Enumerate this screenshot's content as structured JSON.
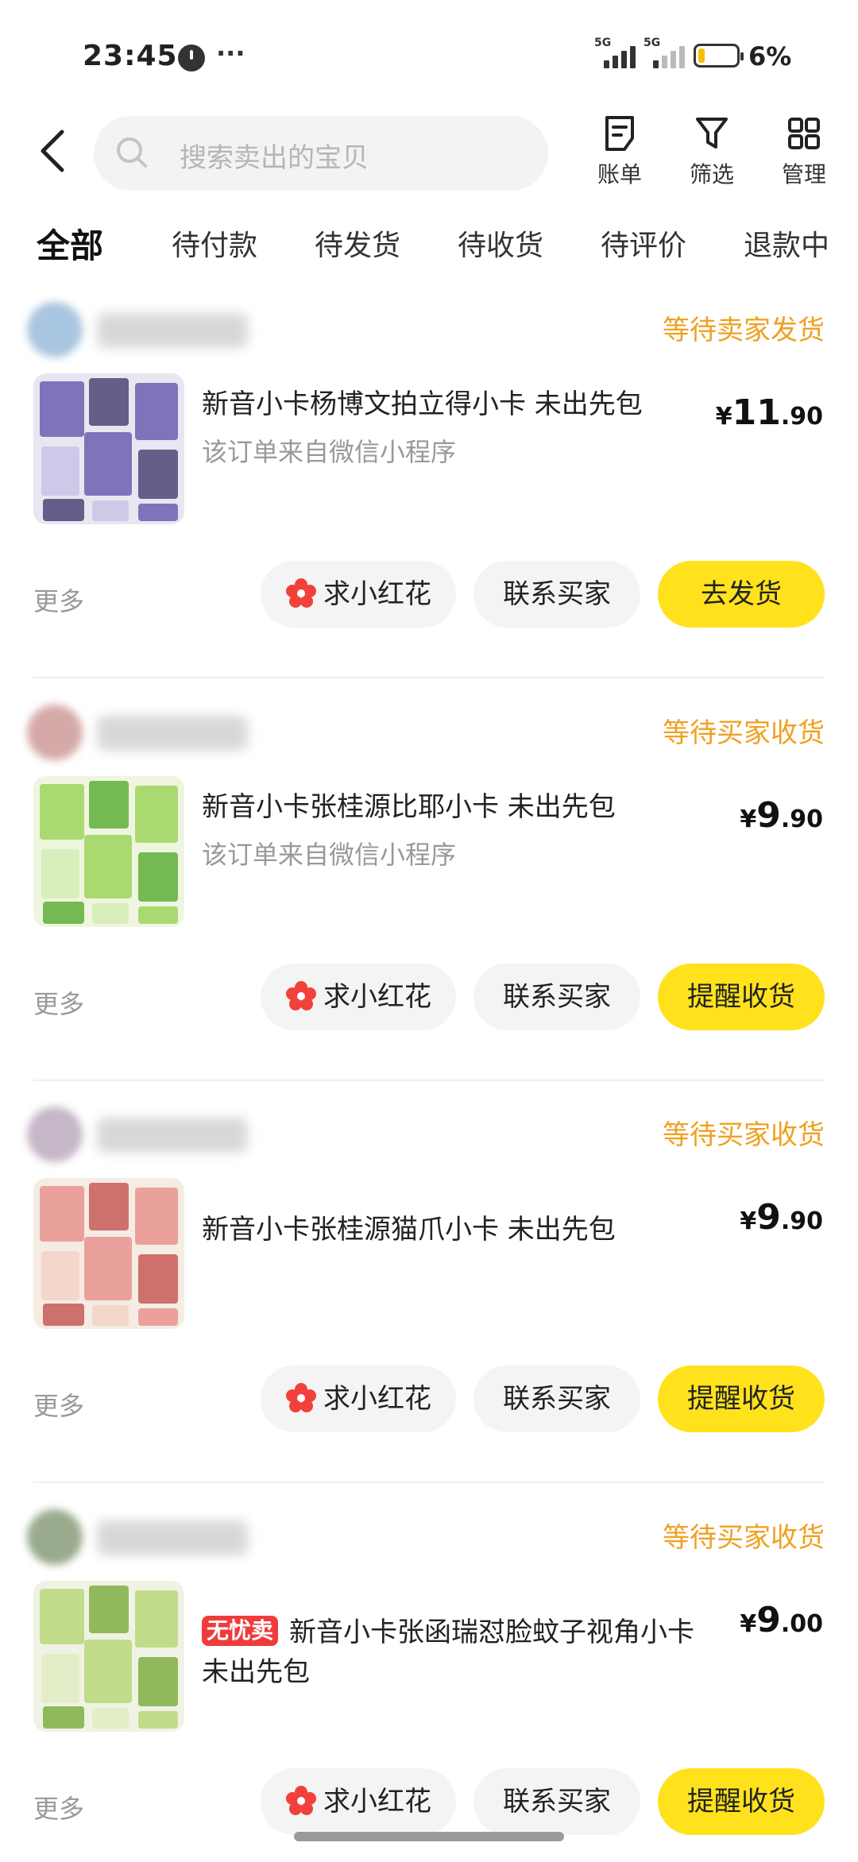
{
  "status_bar": {
    "time": "23:45",
    "overflow": "···",
    "net1": "5G",
    "net2": "5G",
    "battery_pct": "6%"
  },
  "header": {
    "search_placeholder": "搜索卖出的宝贝",
    "buttons": [
      {
        "label": "账单",
        "icon": "bill-icon"
      },
      {
        "label": "筛选",
        "icon": "filter-icon"
      },
      {
        "label": "管理",
        "icon": "grid-icon"
      }
    ]
  },
  "tabs": [
    "全部",
    "待付款",
    "待发货",
    "待收货",
    "待评价",
    "退款中"
  ],
  "orders": [
    {
      "status": "等待卖家发货",
      "badge": "",
      "title": "新音小卡杨博文拍立得小卡 未出先包",
      "source": "该订单来自微信小程序",
      "price_int": "11",
      "price_dec": ".90",
      "more": "更多",
      "btn_flower": "求小红花",
      "btn_contact": "联系买家",
      "btn_primary": "去发货",
      "thumb_colors": [
        "#6b5fb0",
        "#e9e6f2",
        "#4b4676",
        "#c9c3e6"
      ]
    },
    {
      "status": "等待买家收货",
      "badge": "",
      "title": "新音小卡张桂源比耶小卡 未出先包",
      "source": "该订单来自微信小程序",
      "price_int": "9",
      "price_dec": ".90",
      "more": "更多",
      "btn_flower": "求小红花",
      "btn_contact": "联系买家",
      "btn_primary": "提醒收货",
      "thumb_colors": [
        "#9fd35e",
        "#eef6df",
        "#5fae3a",
        "#d4ecb5"
      ]
    },
    {
      "status": "等待买家收货",
      "badge": "",
      "title": "新音小卡张桂源猫爪小卡 未出先包",
      "source": "",
      "price_int": "9",
      "price_dec": ".90",
      "more": "更多",
      "btn_flower": "求小红花",
      "btn_contact": "联系买家",
      "btn_primary": "提醒收货",
      "thumb_colors": [
        "#e8948f",
        "#f5ece4",
        "#c75a57",
        "#f2d3c6"
      ]
    },
    {
      "status": "等待买家收货",
      "badge": "无忧卖",
      "title": "新音小卡张函瑞怼脸蚊子视角小卡 未出先包",
      "source": "",
      "price_int": "9",
      "price_dec": ".00",
      "more": "更多",
      "btn_flower": "求小红花",
      "btn_contact": "联系买家",
      "btn_primary": "提醒收货",
      "thumb_colors": [
        "#b9d77a",
        "#f0f3e4",
        "#7fae44",
        "#e1ecc3"
      ]
    }
  ],
  "price_symbol": "¥",
  "colors": {
    "accent_yellow": "#ffe21c",
    "status_orange": "#f0a020",
    "badge_red": "#ef3b3b"
  }
}
